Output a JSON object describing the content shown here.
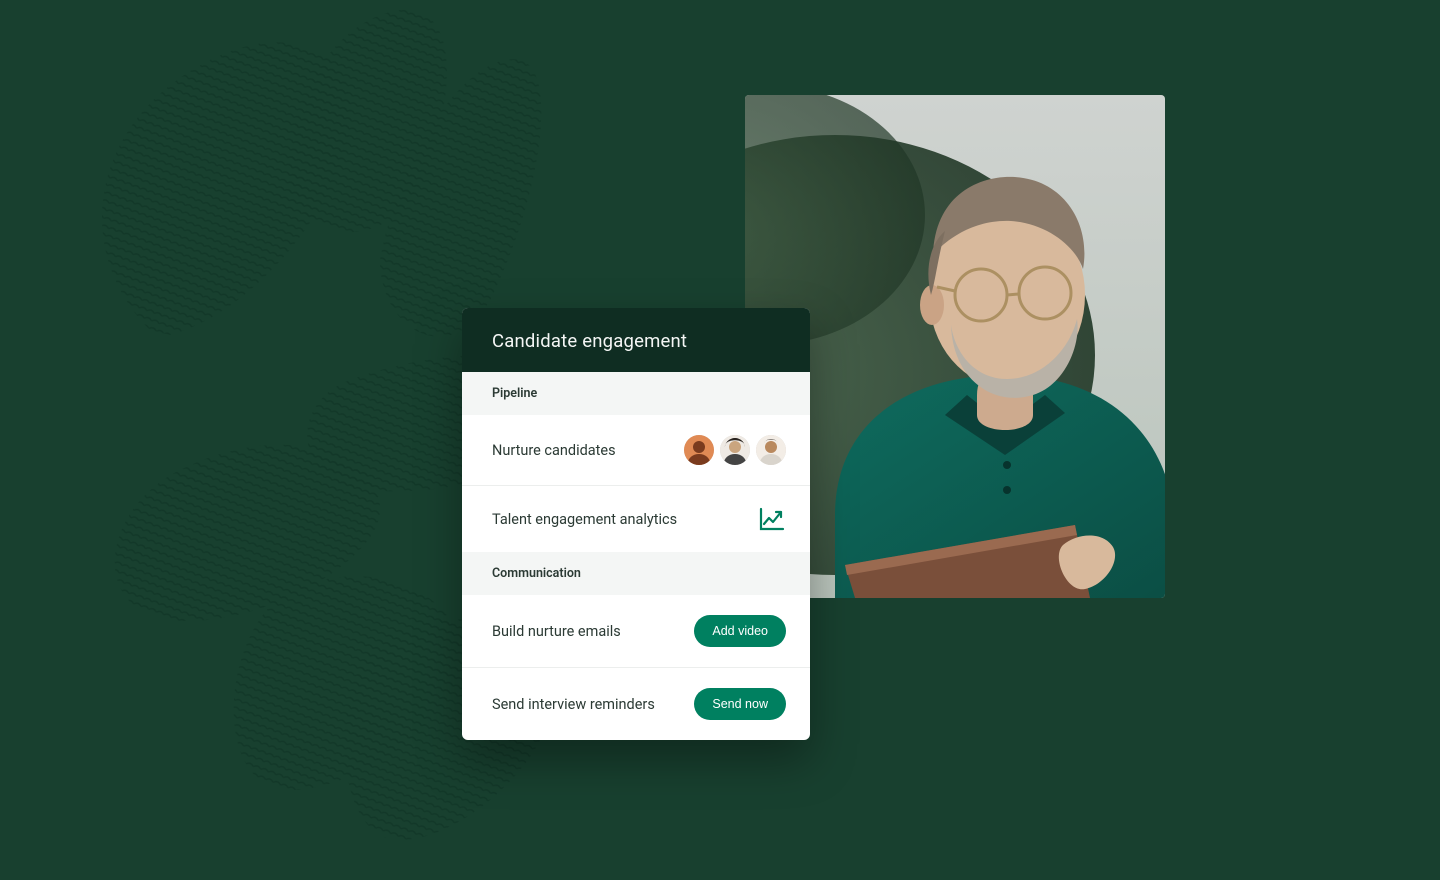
{
  "colors": {
    "background": "#18402f",
    "card_header_bg": "#0f2d22",
    "section_header_bg": "#f4f6f5",
    "accent": "#008060",
    "text_dark": "#2b3a34"
  },
  "card": {
    "title": "Candidate engagement",
    "sections": {
      "pipeline": {
        "header": "Pipeline",
        "rows": {
          "nurture": {
            "label": "Nurture candidates",
            "avatars_count": 3
          },
          "analytics": {
            "label": "Talent engagement analytics",
            "icon": "analytics-up-icon"
          }
        }
      },
      "communication": {
        "header": "Communication",
        "rows": {
          "emails": {
            "label": "Build nurture emails",
            "button": "Add video"
          },
          "reminders": {
            "label": "Send interview reminders",
            "button": "Send now"
          }
        }
      }
    }
  }
}
